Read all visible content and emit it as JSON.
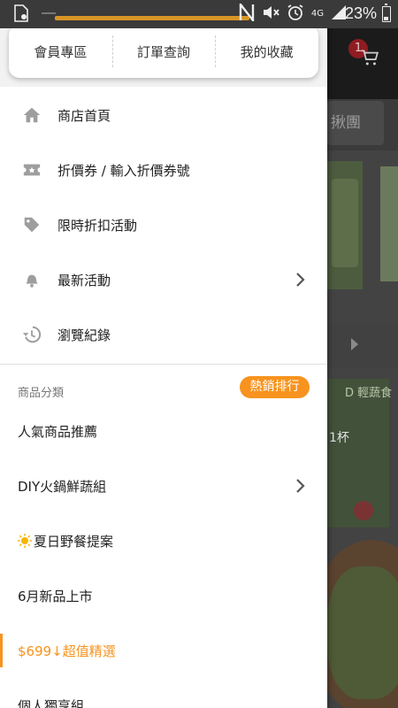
{
  "status_bar": {
    "battery_text": "23%",
    "network": "4G",
    "icons": [
      "sim-icon",
      "notification-n-icon",
      "mute-icon",
      "alarm-icon",
      "signal-icon",
      "battery-icon"
    ]
  },
  "background": {
    "search_hint": "揪團",
    "cart_badge": "1",
    "promo_text_1": "D 輕蔬食",
    "promo_text_2": "1杯"
  },
  "drawer": {
    "quick_links": [
      {
        "label": "會員專區"
      },
      {
        "label": "訂單查詢"
      },
      {
        "label": "我的收藏"
      }
    ],
    "menu": [
      {
        "label": "商店首頁",
        "icon": "home-icon"
      },
      {
        "label": "折價券 / 輸入折價券號",
        "icon": "ticket-icon"
      },
      {
        "label": "限時折扣活動",
        "icon": "tag-icon"
      },
      {
        "label": "最新活動",
        "icon": "bell-icon",
        "has_submenu": true
      },
      {
        "label": "瀏覽紀錄",
        "icon": "history-icon"
      }
    ],
    "category_header": "商品分類",
    "hot_badge": "熱銷排行",
    "categories": [
      {
        "label": "人氣商品推薦"
      },
      {
        "label": "DIY火鍋鮮蔬組",
        "has_submenu": true
      },
      {
        "label": "夏日野餐提案",
        "prefix_icon": "sun-icon"
      },
      {
        "label": "6月新品上市"
      },
      {
        "label": "$699↓超值精選",
        "active": true
      },
      {
        "label": "個人獨享組"
      }
    ]
  },
  "colors": {
    "accent": "#f7931e",
    "icon_gray": "#9e9e9e",
    "text": "#222222"
  }
}
